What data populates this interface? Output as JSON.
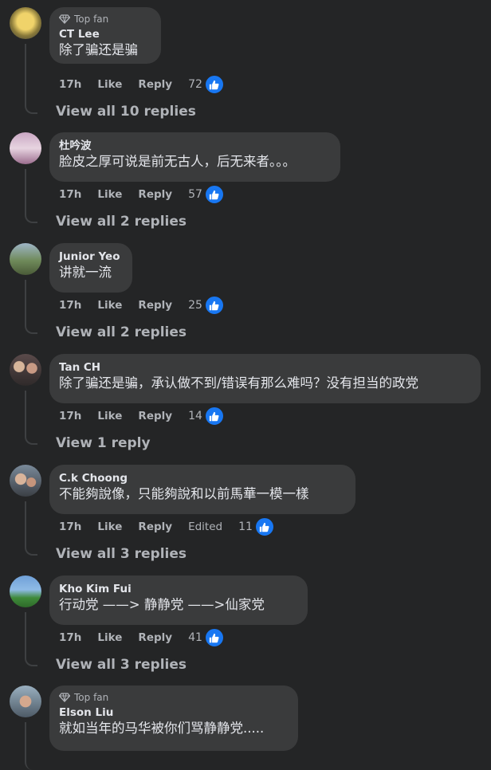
{
  "labels": {
    "like": "Like",
    "reply": "Reply",
    "top_fan": "Top fan",
    "edited": "Edited"
  },
  "comments": [
    {
      "author": "CT Lee",
      "text": "除了骗还是骗",
      "time": "17h",
      "reactions": "72",
      "replies": "View all 10 replies",
      "top_fan": true,
      "edited": false
    },
    {
      "author": "杜吟波",
      "text": "脸皮之厚可说是前无古人，后无来者。。。",
      "time": "17h",
      "reactions": "57",
      "replies": "View all 2 replies",
      "top_fan": false,
      "edited": false
    },
    {
      "author": "Junior Yeo",
      "text": "讲就一流",
      "time": "17h",
      "reactions": "25",
      "replies": "View all 2 replies",
      "top_fan": false,
      "edited": false
    },
    {
      "author": "Tan CH",
      "text": "除了骗还是骗，承认做不到/错误有那么难吗？没有担当的政党",
      "time": "17h",
      "reactions": "14",
      "replies": "View 1 reply",
      "top_fan": false,
      "edited": false
    },
    {
      "author": "C.k Choong",
      "text": "不能夠說像，只能夠說和以前馬華一模一樣",
      "time": "17h",
      "reactions": "11",
      "replies": "View all 3 replies",
      "top_fan": false,
      "edited": true
    },
    {
      "author": "Kho Kim Fui",
      "text": "行动党 ——> 静静党 ——>仙家党",
      "time": "17h",
      "reactions": "41",
      "replies": "View all 3 replies",
      "top_fan": false,
      "edited": false
    },
    {
      "author": "Elson Liu",
      "text": "就如当年的马华被你们骂静静党.....",
      "time": "",
      "reactions": "",
      "replies": "",
      "top_fan": true,
      "edited": false
    }
  ],
  "colors": {
    "background": "#242526",
    "bubble": "#3a3b3c",
    "like_blue": "#1877f2",
    "secondary_text": "#b0b3b8"
  }
}
